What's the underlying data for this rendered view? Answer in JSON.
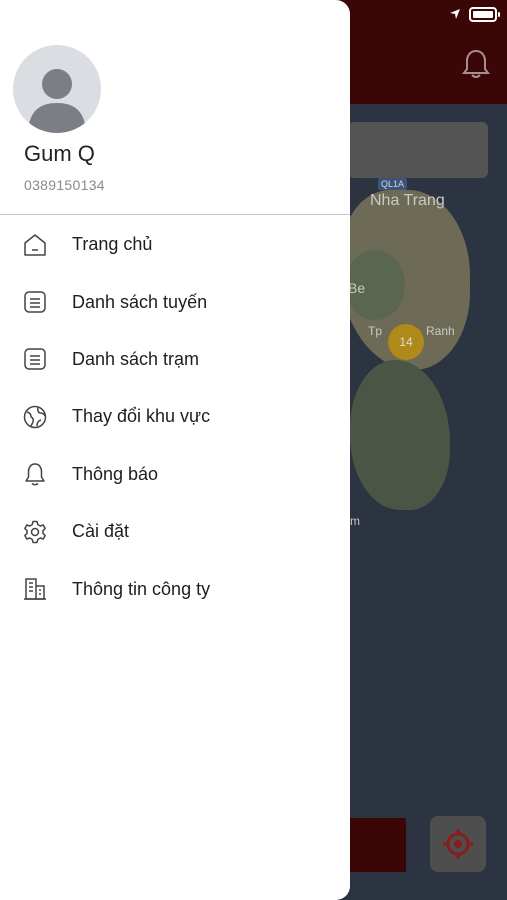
{
  "user": {
    "name": "Gum Q",
    "phone": "0389150134"
  },
  "menu": [
    {
      "label": "Trang chủ",
      "icon": "home-icon"
    },
    {
      "label": "Danh sách tuyến",
      "icon": "list-icon"
    },
    {
      "label": "Danh sách trạm",
      "icon": "list-icon"
    },
    {
      "label": "Thay đổi khu vực",
      "icon": "globe-icon"
    },
    {
      "label": "Thông báo",
      "icon": "bell-icon"
    },
    {
      "label": "Cài đặt",
      "icon": "gear-icon"
    },
    {
      "label": "Thông tin công ty",
      "icon": "building-icon"
    }
  ],
  "map": {
    "city_label": "Nha Trang",
    "road_badge": "QL1A",
    "label_be": "Be",
    "label_tp": "Tp",
    "label_ranh": "Ranh",
    "label_m": "m",
    "cluster_count": "14"
  },
  "colors": {
    "header": "#3a0606",
    "drawer": "#ffffff",
    "map": "#2b3440"
  }
}
